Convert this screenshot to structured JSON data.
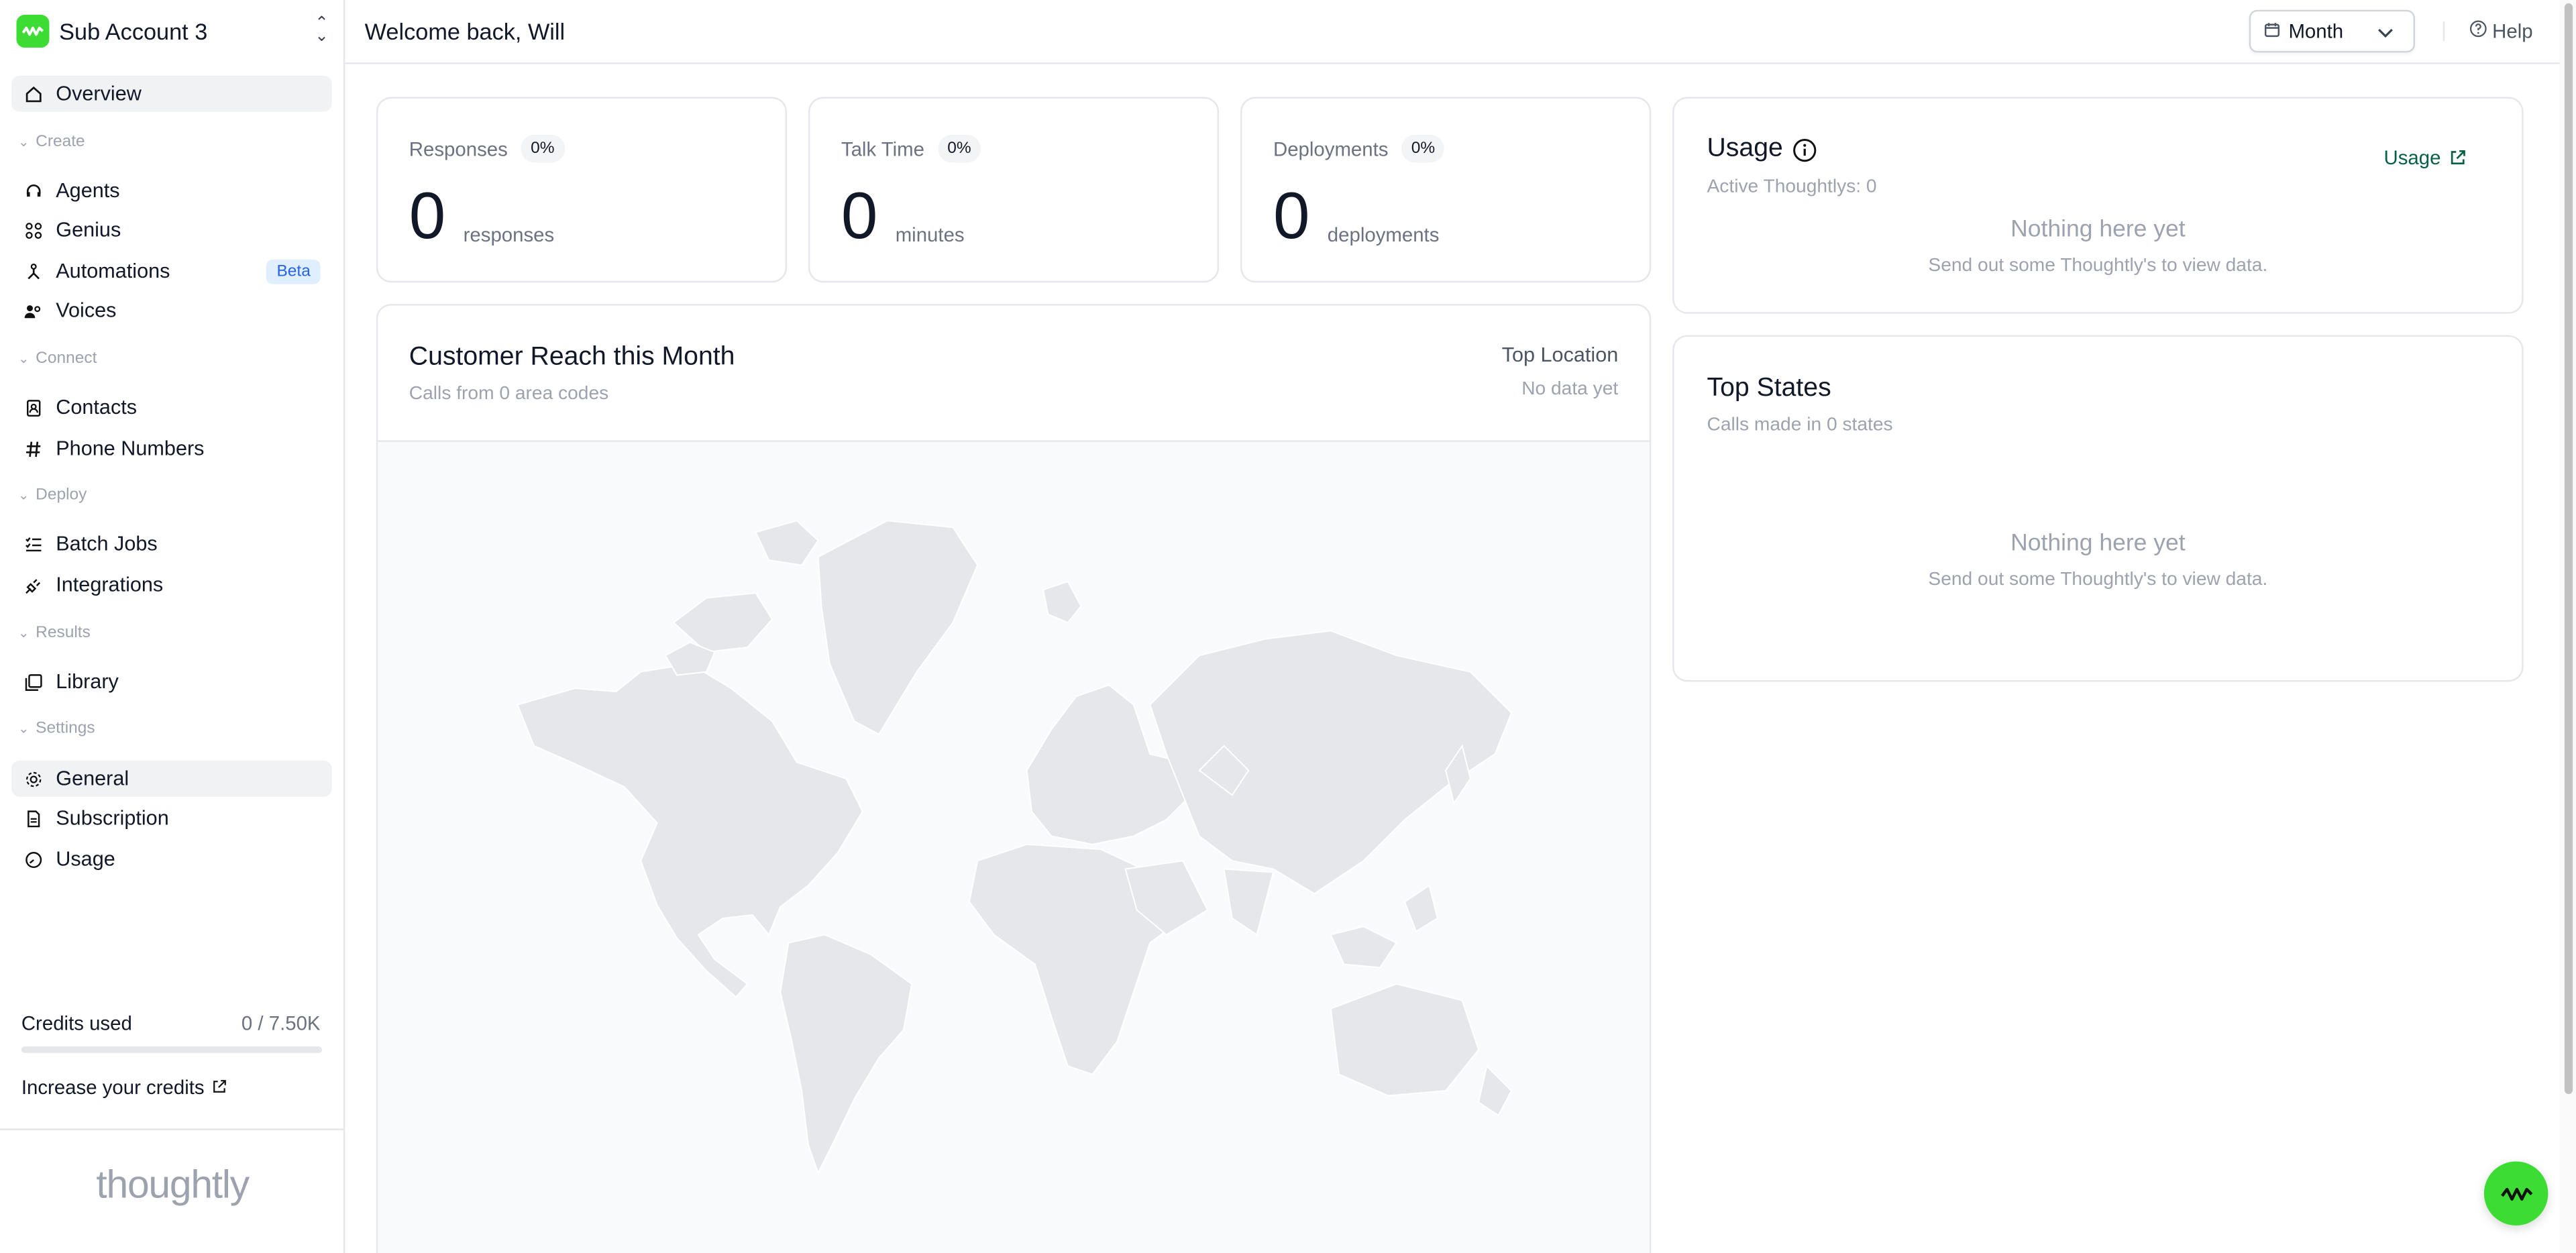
{
  "account": {
    "name": "Sub Account 3"
  },
  "header": {
    "welcome": "Welcome back, Will",
    "period_selected": "Month",
    "help_label": "Help"
  },
  "sidebar": {
    "overview": "Overview",
    "sections": {
      "create": "Create",
      "connect": "Connect",
      "deploy": "Deploy",
      "results": "Results",
      "settings": "Settings"
    },
    "items": {
      "agents": "Agents",
      "genius": "Genius",
      "automations": "Automations",
      "automations_badge": "Beta",
      "voices": "Voices",
      "contacts": "Contacts",
      "phone_numbers": "Phone Numbers",
      "batch_jobs": "Batch Jobs",
      "integrations": "Integrations",
      "library": "Library",
      "general": "General",
      "subscription": "Subscription",
      "usage": "Usage"
    },
    "credits": {
      "label": "Credits used",
      "value": "0 / 7.50K",
      "used_fraction": 0,
      "increase_label": "Increase your credits"
    },
    "wordmark": "thoughtly"
  },
  "stats": {
    "responses": {
      "label": "Responses",
      "change": "0%",
      "value": "0",
      "unit": "responses"
    },
    "talk_time": {
      "label": "Talk Time",
      "change": "0%",
      "value": "0",
      "unit": "minutes"
    },
    "deployments": {
      "label": "Deployments",
      "change": "0%",
      "value": "0",
      "unit": "deployments"
    }
  },
  "reach": {
    "title": "Customer Reach this Month",
    "subtitle": "Calls from 0 area codes",
    "top_location_label": "Top Location",
    "top_location_value": "No data yet"
  },
  "usage": {
    "title": "Usage",
    "active": "Active Thoughtlys: 0",
    "link_label": "Usage",
    "empty_title": "Nothing here yet",
    "empty_sub": "Send out some Thoughtly's to view data."
  },
  "top_states": {
    "title": "Top States",
    "subtitle": "Calls made in 0 states",
    "empty_title": "Nothing here yet",
    "empty_sub": "Send out some Thoughtly's to view data."
  },
  "colors": {
    "brand": "#3ddc34",
    "link": "#065f46",
    "beta_bg": "#e0efff",
    "beta_text": "#2563eb"
  }
}
